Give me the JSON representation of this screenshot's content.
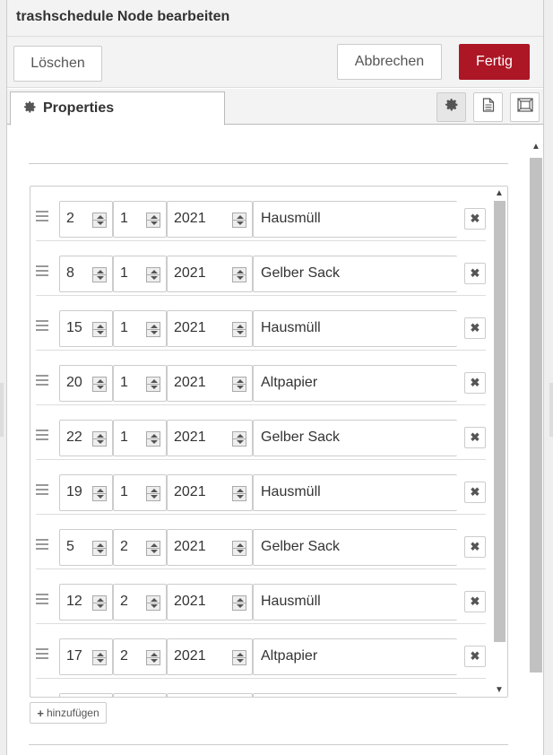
{
  "header": {
    "title": "trashschedule Node bearbeiten"
  },
  "toolbar": {
    "delete_label": "Löschen",
    "cancel_label": "Abbrechen",
    "done_label": "Fertig"
  },
  "tabs": [
    {
      "label": "Properties"
    }
  ],
  "colors": {
    "primary_button": "#AD1625"
  },
  "entries": [
    {
      "day": "2",
      "month": "1",
      "year": "2021",
      "type": "Hausmüll"
    },
    {
      "day": "8",
      "month": "1",
      "year": "2021",
      "type": "Gelber Sack"
    },
    {
      "day": "15",
      "month": "1",
      "year": "2021",
      "type": "Hausmüll"
    },
    {
      "day": "20",
      "month": "1",
      "year": "2021",
      "type": "Altpapier"
    },
    {
      "day": "22",
      "month": "1",
      "year": "2021",
      "type": "Gelber Sack"
    },
    {
      "day": "19",
      "month": "1",
      "year": "2021",
      "type": "Hausmüll"
    },
    {
      "day": "5",
      "month": "2",
      "year": "2021",
      "type": "Gelber Sack"
    },
    {
      "day": "12",
      "month": "2",
      "year": "2021",
      "type": "Hausmüll"
    },
    {
      "day": "17",
      "month": "2",
      "year": "2021",
      "type": "Altpapier"
    }
  ],
  "add_button": {
    "label": "hinzufügen"
  },
  "icons": {
    "gear": "gear-icon",
    "doc": "document-icon",
    "frame": "frame-icon",
    "remove": "remove-icon",
    "plus": "plus-icon",
    "drag": "drag-handle-icon"
  }
}
